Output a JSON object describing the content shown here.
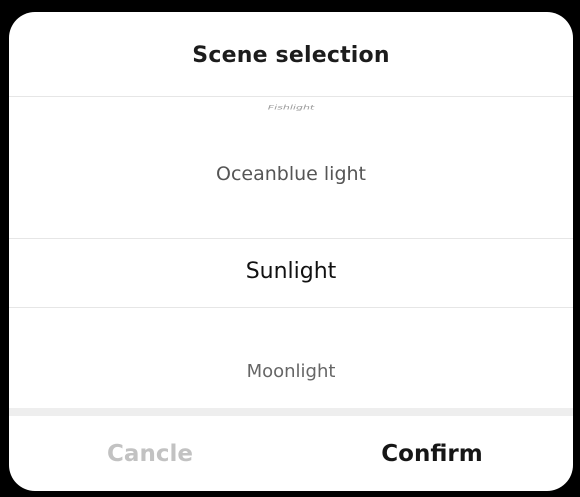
{
  "dialog": {
    "title": "Scene selection",
    "options": {
      "faded_top": "Fishlight",
      "near_top": "Oceanblue light",
      "selected": "Sunlight",
      "near_bottom": "Moonlight"
    },
    "buttons": {
      "cancel_label": "Cancle",
      "confirm_label": "Confirm"
    }
  },
  "colors": {
    "backdrop": "#000000",
    "surface": "#ffffff",
    "disabled_text": "#c2c2c2",
    "primary_text": "#161616"
  }
}
